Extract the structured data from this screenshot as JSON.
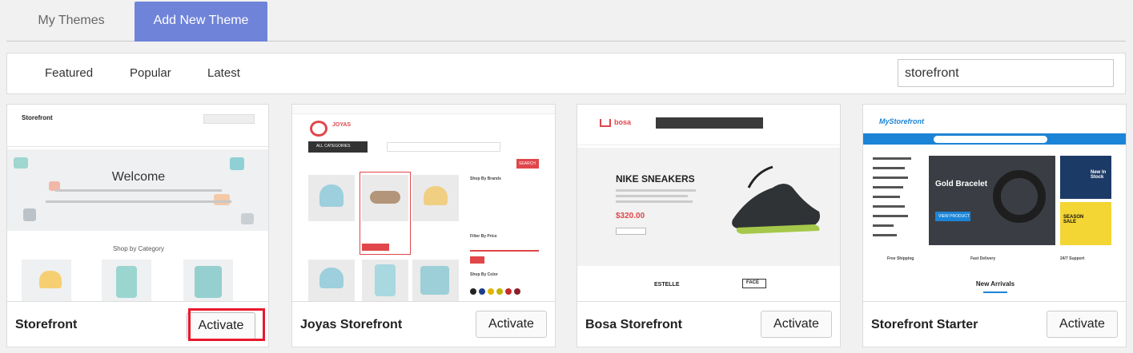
{
  "tabs": {
    "my_themes": "My Themes",
    "add_new": "Add New Theme"
  },
  "filters": {
    "featured": "Featured",
    "popular": "Popular",
    "latest": "Latest"
  },
  "search": {
    "value": "storefront"
  },
  "cards": [
    {
      "name": "Storefront",
      "action": "Activate",
      "preview": {
        "logo": "Storefront",
        "welcome": "Welcome",
        "shop_by_category": "Shop by Category"
      }
    },
    {
      "name": "Joyas Storefront",
      "action": "Activate",
      "preview": {
        "logo": "JOYAS",
        "categories": "ALL CATEGORIES",
        "search_btn": "SEARCH",
        "shop_by_brands": "Shop By Brands",
        "filter_by_price": "Filter By Price",
        "shop_by_color": "Shop By Color"
      }
    },
    {
      "name": "Bosa Storefront",
      "action": "Activate",
      "preview": {
        "logo": "bosa",
        "headline": "NIKE SNEAKERS",
        "price": "$320.00",
        "brands": [
          "ESTELLE",
          "FACE"
        ]
      }
    },
    {
      "name": "Storefront Starter",
      "action": "Activate",
      "preview": {
        "logo": "MyStorefront",
        "promo": "Gold Bracelet",
        "view_product": "VIEW PRODUCT",
        "features": [
          "Free Shipping",
          "Fast Delivery",
          "24/7 Support"
        ],
        "new_arrivals": "New Arrivals",
        "side_promo_1": "New In Stock",
        "side_promo_2": "SEASON SALE"
      }
    }
  ]
}
